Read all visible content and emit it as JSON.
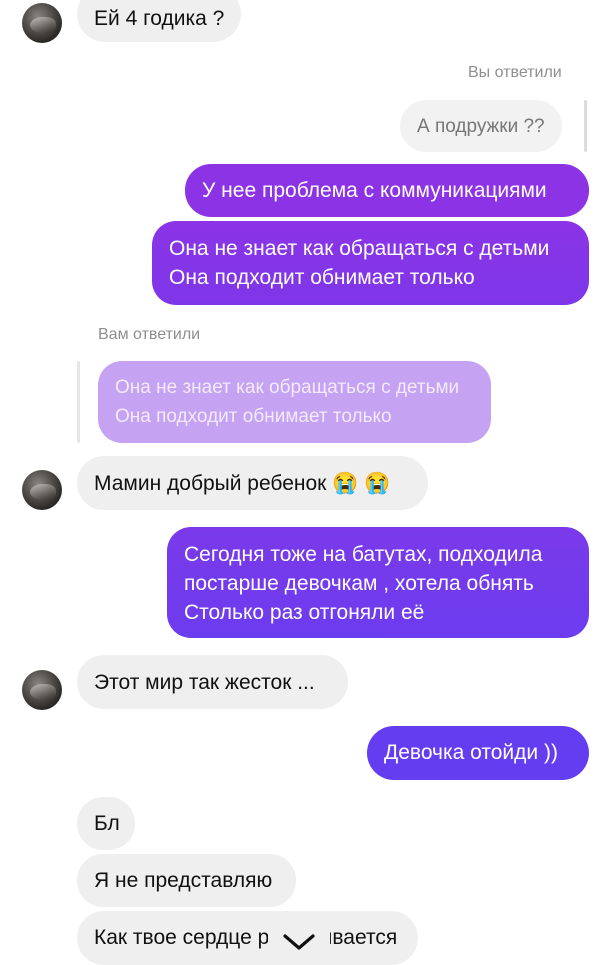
{
  "messages": {
    "m1": "Ей 4 годика ?",
    "reply_label_you": "Вы ответили",
    "m2": "А подружки ??",
    "m3": "У нее проблема с коммуникациями",
    "m4_line1": "Она не знает как обращаться с детьми",
    "m4_line2": "Она подходит обнимает только",
    "reply_label_them": "Вам ответили",
    "q_line1": "Она не знает как обращаться с детьми",
    "q_line2": "Она подходит обнимает только",
    "m5": "Мамин добрый ребенок 😭 😭",
    "m6_line1": "Сегодня тоже на батутах, подходила",
    "m6_line2": "постарше девочкам , хотела обнять",
    "m6_line3": "Столько раз отгоняли её",
    "m7": "Этот мир так жесток ...",
    "m8": "Девочка отойди ))",
    "m9": "Бл",
    "m10": "Я не представляю",
    "m11_left": "Как твое сердце р",
    "m11_right": "ывается"
  },
  "icons": {
    "scroll_down": "chevron-down-icon"
  },
  "colors": {
    "incoming_bg": "#efefef",
    "outgoing_top": "#8a33e6",
    "outgoing_bottom": "#6b3cf0",
    "quote_bg": "#c3a0f2",
    "muted_text": "#8e8e8e"
  }
}
